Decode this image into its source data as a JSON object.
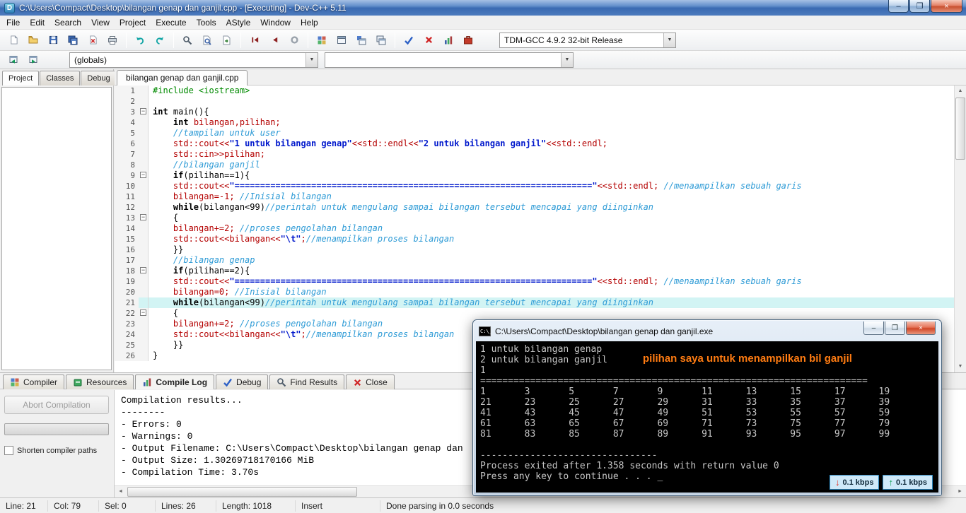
{
  "window": {
    "title": "C:\\Users\\Compact\\Desktop\\bilangan genap dan ganjil.cpp - [Executing] - Dev-C++ 5.11"
  },
  "menu": [
    "File",
    "Edit",
    "Search",
    "View",
    "Project",
    "Execute",
    "Tools",
    "AStyle",
    "Window",
    "Help"
  ],
  "toolbar": {
    "compiler_profile": "TDM-GCC 4.9.2 32-bit Release",
    "groups": [
      [
        {
          "name": "new-file",
          "icon": "page"
        },
        {
          "name": "open-file",
          "icon": "folder"
        },
        {
          "name": "save",
          "icon": "floppy"
        },
        {
          "name": "save-all",
          "icon": "floppy-multi"
        },
        {
          "name": "close-file",
          "icon": "page-close"
        },
        {
          "name": "print",
          "icon": "printer"
        }
      ],
      [
        {
          "name": "undo",
          "icon": "undo"
        },
        {
          "name": "redo",
          "icon": "redo"
        }
      ],
      [
        {
          "name": "find",
          "icon": "find"
        },
        {
          "name": "replace",
          "icon": "find-page"
        },
        {
          "name": "goto-line",
          "icon": "goto-page"
        }
      ],
      [
        {
          "name": "jump-back",
          "icon": "arrow-left-bar"
        },
        {
          "name": "jump-forward",
          "icon": "arrow-left"
        },
        {
          "name": "toggle-breakpoint",
          "icon": "circle"
        }
      ],
      [
        {
          "name": "compile",
          "icon": "compile-grid"
        },
        {
          "name": "run",
          "icon": "window"
        },
        {
          "name": "compile-run",
          "icon": "compile-window"
        },
        {
          "name": "rebuild-all",
          "icon": "windows"
        }
      ],
      [
        {
          "name": "syntax-check",
          "icon": "check"
        },
        {
          "name": "abort-compile",
          "icon": "red-x"
        },
        {
          "name": "profile-analysis",
          "icon": "bar-chart"
        },
        {
          "name": "package-manager",
          "icon": "red-case"
        }
      ]
    ]
  },
  "navrow": {
    "buttons": [
      {
        "name": "previous-unit",
        "icon": "window-arrow-left"
      },
      {
        "name": "next-unit",
        "icon": "window-arrow-right"
      }
    ],
    "globals": "(globals)",
    "members": ""
  },
  "sidebar": {
    "tabs": [
      "Project",
      "Classes",
      "Debug"
    ],
    "active": "Project"
  },
  "editor": {
    "tab": "bilangan genap dan ganjil.cpp",
    "active_line": 21,
    "fold_lines": [
      3,
      9,
      13,
      18,
      22
    ],
    "lines": [
      [
        [
          "pp",
          "#include <iostream>"
        ]
      ],
      [],
      [
        [
          "kw",
          "int"
        ],
        [
          "pl",
          " main(){"
        ]
      ],
      [
        [
          "pl",
          "    "
        ],
        [
          "kw",
          "int"
        ],
        [
          "rd",
          " bilangan,pilihan;"
        ]
      ],
      [
        [
          "pl",
          "    "
        ],
        [
          "cm",
          "//tampilan untuk user"
        ]
      ],
      [
        [
          "pl",
          "    "
        ],
        [
          "rd",
          "std::cout<<"
        ],
        [
          "st",
          "\"1 untuk bilangan genap\""
        ],
        [
          "rd",
          "<<std::endl<<"
        ],
        [
          "st",
          "\"2 untuk bilangan ganjil\""
        ],
        [
          "rd",
          "<<std::endl;"
        ]
      ],
      [
        [
          "pl",
          "    "
        ],
        [
          "rd",
          "std::cin>>pilihan;"
        ]
      ],
      [
        [
          "pl",
          "    "
        ],
        [
          "cm",
          "//bilangan ganjil"
        ]
      ],
      [
        [
          "pl",
          "    "
        ],
        [
          "kw",
          "if"
        ],
        [
          "pl",
          "(pilihan==1){"
        ]
      ],
      [
        [
          "pl",
          "    "
        ],
        [
          "rd",
          "std::cout<<"
        ],
        [
          "st",
          "\"======================================================================\""
        ],
        [
          "rd",
          "<<std::endl;"
        ],
        [
          "pl",
          " "
        ],
        [
          "cm",
          "//menaampilkan sebuah garis"
        ]
      ],
      [
        [
          "pl",
          "    "
        ],
        [
          "rd",
          "bilangan=-1; "
        ],
        [
          "cm",
          "//Inisial bilangan"
        ]
      ],
      [
        [
          "pl",
          "    "
        ],
        [
          "kw",
          "while"
        ],
        [
          "pl",
          "(bilangan<99)"
        ],
        [
          "cm",
          "//perintah untuk mengulang sampai bilangan tersebut mencapai yang diinginkan"
        ]
      ],
      [
        [
          "pl",
          "    {"
        ]
      ],
      [
        [
          "pl",
          "    "
        ],
        [
          "rd",
          "bilangan+=2; "
        ],
        [
          "cm",
          "//proses pengolahan bilangan"
        ]
      ],
      [
        [
          "pl",
          "    "
        ],
        [
          "rd",
          "std::cout<<bilangan<<"
        ],
        [
          "st",
          "\"\\t\""
        ],
        [
          "rd",
          ";"
        ],
        [
          "cm",
          "//menampilkan proses bilangan"
        ]
      ],
      [
        [
          "pl",
          "    }}"
        ]
      ],
      [
        [
          "pl",
          "    "
        ],
        [
          "cm",
          "//bilangan genap"
        ]
      ],
      [
        [
          "pl",
          "    "
        ],
        [
          "kw",
          "if"
        ],
        [
          "pl",
          "(pilihan==2){"
        ]
      ],
      [
        [
          "pl",
          "    "
        ],
        [
          "rd",
          "std::cout<<"
        ],
        [
          "st",
          "\"======================================================================\""
        ],
        [
          "rd",
          "<<std::endl;"
        ],
        [
          "pl",
          " "
        ],
        [
          "cm",
          "//menaampilkan sebuah garis"
        ]
      ],
      [
        [
          "pl",
          "    "
        ],
        [
          "rd",
          "bilangan=0; "
        ],
        [
          "cm",
          "//Inisial bilangan"
        ]
      ],
      [
        [
          "pl",
          "    "
        ],
        [
          "kw",
          "while"
        ],
        [
          "pl",
          "(bilangan<99)"
        ],
        [
          "cm",
          "//perintah untuk mengulang sampai bilangan tersebut mencapai yang diinginkan"
        ]
      ],
      [
        [
          "pl",
          "    {"
        ]
      ],
      [
        [
          "pl",
          "    "
        ],
        [
          "rd",
          "bilangan+=2; "
        ],
        [
          "cm",
          "//proses pengolahan bilangan"
        ]
      ],
      [
        [
          "pl",
          "    "
        ],
        [
          "rd",
          "std::cout<<bilangan<<"
        ],
        [
          "st",
          "\"\\t\""
        ],
        [
          "rd",
          ";"
        ],
        [
          "cm",
          "//menampilkan proses bilangan"
        ]
      ],
      [
        [
          "pl",
          "    }}"
        ]
      ],
      [
        [
          "pl",
          "}"
        ]
      ]
    ]
  },
  "bottom": {
    "tabs": [
      {
        "label": "Compiler",
        "icon": "compile-grid"
      },
      {
        "label": "Resources",
        "icon": "book"
      },
      {
        "label": "Compile Log",
        "icon": "bar-chart"
      },
      {
        "label": "Debug",
        "icon": "check"
      },
      {
        "label": "Find Results",
        "icon": "find"
      },
      {
        "label": "Close",
        "icon": "red-x"
      }
    ],
    "active": "Compile Log",
    "abort_label": "Abort Compilation",
    "shorten_label": "Shorten compiler paths",
    "log": [
      "Compilation results...",
      "--------",
      "- Errors: 0",
      "- Warnings: 0",
      "- Output Filename: C:\\Users\\Compact\\Desktop\\bilangan genap dan",
      "- Output Size: 1.30269718170166 MiB",
      "- Compilation Time: 3.70s"
    ]
  },
  "statusbar": {
    "names": [
      "line",
      "col",
      "sel",
      "lines",
      "length",
      "insert-mode",
      "parse-status"
    ],
    "items": [
      "Line: 21",
      "Col: 79",
      "Sel: 0",
      "Lines: 26",
      "Length: 1018",
      "Insert",
      "Done parsing in 0.0 seconds"
    ]
  },
  "console": {
    "title": "C:\\Users\\Compact\\Desktop\\bilangan genap dan ganjil.exe",
    "annotation": "pilihan saya untuk menampilkan bil ganjil",
    "cursor": "_",
    "lines": [
      "1 untuk bilangan genap",
      "2 untuk bilangan ganjil",
      "1",
      "======================================================================",
      "1\t3\t5\t7\t9\t11\t13\t15\t17\t19",
      "21\t23\t25\t27\t29\t31\t33\t35\t37\t39",
      "41\t43\t45\t47\t49\t51\t53\t55\t57\t59",
      "61\t63\t65\t67\t69\t71\t73\t75\t77\t79",
      "81\t83\t85\t87\t89\t91\t93\t95\t97\t99",
      " ",
      "--------------------------------",
      "Process exited after 1.358 seconds with return value 0",
      "Press any key to continue . . . "
    ]
  },
  "net": {
    "down": "0.1 kbps",
    "up": "0.1 kbps"
  }
}
